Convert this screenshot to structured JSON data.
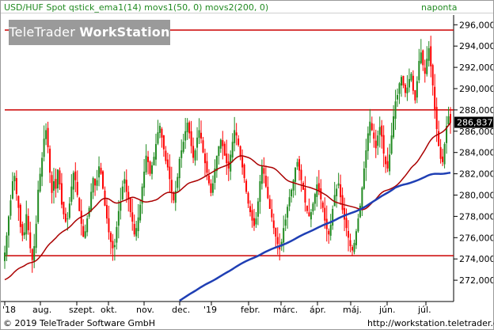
{
  "header": {
    "left": "USD/HUF Spot qstick_ema1(14) movs1(50, 0) movs2(200, 0)",
    "right": "naponta"
  },
  "watermark": {
    "brand": "TeleTrader",
    "product": "WorkStation"
  },
  "footer": {
    "copyright": "© 2019 TeleTrader Software GmbH",
    "url": "http://workstation.teletrader.com"
  },
  "colors": {
    "up": "#228b22",
    "down": "#ff0000",
    "ma50": "#aa0000",
    "ma200": "#1f3fb4",
    "level_line": "#cc0000",
    "price_label_bg": "#000000"
  },
  "chart_data": {
    "type": "candlestick",
    "title": "",
    "xlabel": "",
    "ylabel": "",
    "ylim": [
      270000,
      297000
    ],
    "y_ticks": [
      "272,0000",
      "274,0000",
      "276,0000",
      "278,0000",
      "280,0000",
      "282,0000",
      "284,0000",
      "286,0000",
      "288,0000",
      "290,0000",
      "292,0000",
      "294,0000",
      "296,0000"
    ],
    "x_ticks": [
      "'18",
      "aug.",
      "szept.",
      "okt.",
      "nov.",
      "dec.",
      "'19",
      "febr.",
      "márc.",
      "ápr.",
      "máj.",
      "jún.",
      "júl."
    ],
    "last_price_label": "286,8370",
    "last_price": 286.837,
    "horizontal_lines": [
      295.5,
      288.0,
      274.3
    ],
    "series": [
      {
        "kind": "candles",
        "closes": [
          274.6,
          276.2,
          278.0,
          279.5,
          281.3,
          281.8,
          280.1,
          278.8,
          277.0,
          276.2,
          276.5,
          278.2,
          276.7,
          275.0,
          273.9,
          275.2,
          277.3,
          280.5,
          282.0,
          283.5,
          285.3,
          286.1,
          284.5,
          282.1,
          280.2,
          281.3,
          280.6,
          282.4,
          281.0,
          279.1,
          278.2,
          277.5,
          277.8,
          279.2,
          280.8,
          282.1,
          281.4,
          280.0,
          278.5,
          277.3,
          276.1,
          276.6,
          277.8,
          278.8,
          280.3,
          281.6,
          280.9,
          281.4,
          282.7,
          282.0,
          280.6,
          279.0,
          277.8,
          276.5,
          275.6,
          275.0,
          275.3,
          277.0,
          278.5,
          279.4,
          280.8,
          281.5,
          280.3,
          279.6,
          278.4,
          277.5,
          276.3,
          276.9,
          277.9,
          279.1,
          280.8,
          282.2,
          283.7,
          283.1,
          282.0,
          282.8,
          283.6,
          284.8,
          285.9,
          286.5,
          285.4,
          284.3,
          283.2,
          282.6,
          281.5,
          280.3,
          279.5,
          280.4,
          281.7,
          283.4,
          284.2,
          285.0,
          286.0,
          286.8,
          285.8,
          284.6,
          283.5,
          284.2,
          285.4,
          286.1,
          285.3,
          284.0,
          283.0,
          282.1,
          281.1,
          280.2,
          281.1,
          282.5,
          283.7,
          284.6,
          285.2,
          284.6,
          283.7,
          283.0,
          282.5,
          283.8,
          285.0,
          286.1,
          285.6,
          284.7,
          283.6,
          282.6,
          281.6,
          280.3,
          279.2,
          278.4,
          277.6,
          277.1,
          277.8,
          279.4,
          281.3,
          282.7,
          282.0,
          280.8,
          279.7,
          278.7,
          277.9,
          276.9,
          276.1,
          275.4,
          274.9,
          275.6,
          276.9,
          277.7,
          278.9,
          279.8,
          280.5,
          281.4,
          282.6,
          283.1,
          282.3,
          281.4,
          280.5,
          279.3,
          278.5,
          278.0,
          278.4,
          279.2,
          280.1,
          281.0,
          280.4,
          279.6,
          278.8,
          277.6,
          276.8,
          276.3,
          277.2,
          278.7,
          280.0,
          280.6,
          281.1,
          279.8,
          278.6,
          277.7,
          276.9,
          276.0,
          275.2,
          274.8,
          275.5,
          276.6,
          277.8,
          279.0,
          280.7,
          282.5,
          284.2,
          285.8,
          286.9,
          286.1,
          285.3,
          284.4,
          285.6,
          286.4,
          285.5,
          283.9,
          282.9,
          282.5,
          283.8,
          285.6,
          287.4,
          288.8,
          289.4,
          290.5,
          291.1,
          290.3,
          289.6,
          290.1,
          290.9,
          291.4,
          289.8,
          288.9,
          290.7,
          292.6,
          293.4,
          292.2,
          291.4,
          292.8,
          293.8,
          292.1,
          290.3,
          288.0,
          286.2,
          284.6,
          283.4,
          283.1,
          284.8,
          286.5,
          287.4,
          286.8
        ]
      },
      {
        "name": "movs1(50, 0)",
        "kind": "ma",
        "period": 50
      },
      {
        "name": "movs2(200, 0)",
        "kind": "ma",
        "period": 200
      }
    ]
  }
}
